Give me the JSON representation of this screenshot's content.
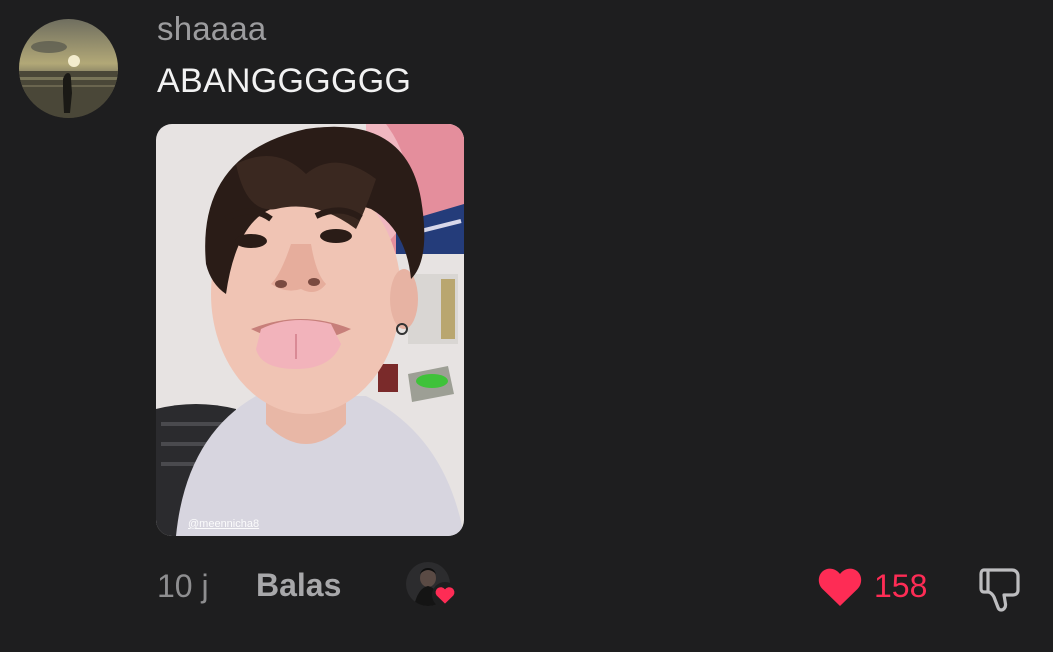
{
  "comment": {
    "username": "shaaaa",
    "text": "ABANGGGGGG",
    "photo_watermark": "@meennicha8",
    "time": "10 j",
    "reply_label": "Balas",
    "like_count": "158",
    "liked": true
  },
  "icons": {
    "like": "heart-icon",
    "dislike": "thumbs-down-icon",
    "creator_liked": "heart-icon"
  },
  "colors": {
    "background": "#1e1e1f",
    "like_accent": "#fe2c55",
    "username": "#9c9c9e",
    "text": "#f2f2f2"
  }
}
